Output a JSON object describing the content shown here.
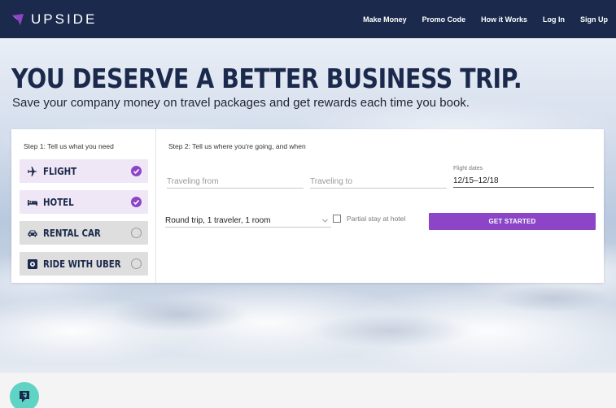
{
  "brand": {
    "name": "UPSIDE",
    "accent": "#8c45c6",
    "navy": "#1b2a4c"
  },
  "nav": {
    "items": [
      {
        "label": "Make Money"
      },
      {
        "label": "Promo Code"
      },
      {
        "label": "How it Works"
      },
      {
        "label": "Log In"
      },
      {
        "label": "Sign Up"
      }
    ]
  },
  "hero": {
    "headline": "YOU DESERVE A BETTER BUSINESS TRIP.",
    "subhead": "Save your company money on travel packages and get rewards each time you book."
  },
  "booking": {
    "step1_label": "Step 1: Tell us what you need",
    "step2_label": "Step 2: Tell us where you're going, and when",
    "options": [
      {
        "label": "FLIGHT",
        "icon": "airplane-icon",
        "selected": true
      },
      {
        "label": "HOTEL",
        "icon": "bed-icon",
        "selected": true
      },
      {
        "label": "RENTAL CAR",
        "icon": "car-icon",
        "selected": false
      },
      {
        "label": "RIDE WITH UBER",
        "icon": "uber-icon",
        "selected": false
      }
    ],
    "traveling_from_placeholder": "Traveling from",
    "traveling_to_placeholder": "Traveling to",
    "flight_dates_label": "Flight dates",
    "flight_dates_value": "12/15–12/18",
    "trip_summary": "Round trip, 1 traveler, 1 room",
    "partial_stay_label": "Partial stay at hotel",
    "partial_stay_checked": false,
    "cta_label": "GET STARTED"
  },
  "chat": {
    "icon": "chat-icon"
  }
}
